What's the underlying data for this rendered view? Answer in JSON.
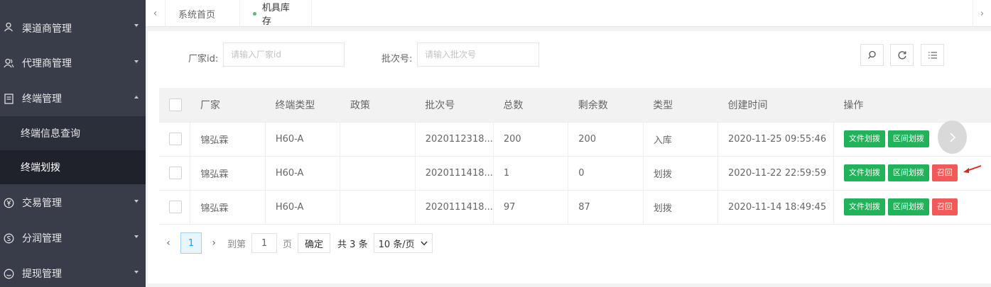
{
  "sidebar": {
    "items": [
      {
        "label": "渠道商管理",
        "icon": "user-icon",
        "expanded": false
      },
      {
        "label": "代理商管理",
        "icon": "users-icon",
        "expanded": false
      },
      {
        "label": "终端管理",
        "icon": "device-icon",
        "expanded": true,
        "children": [
          {
            "label": "终端信息查询",
            "active": false
          },
          {
            "label": "终端划拨",
            "active": true
          }
        ]
      },
      {
        "label": "交易管理",
        "icon": "yen-icon",
        "expanded": false
      },
      {
        "label": "分润管理",
        "icon": "dollar-icon",
        "expanded": false
      },
      {
        "label": "提现管理",
        "icon": "withdraw-icon",
        "expanded": false
      }
    ]
  },
  "tabs": [
    {
      "label": "系统首页",
      "active": false
    },
    {
      "label": "机具库存",
      "active": true
    }
  ],
  "search": {
    "manufacturer_label": "厂家id:",
    "manufacturer_placeholder": "请输入厂家id",
    "batch_label": "批次号:",
    "batch_placeholder": "请输入批次号"
  },
  "table": {
    "columns": [
      "厂家",
      "终端类型",
      "政策",
      "批次号",
      "总数",
      "剩余数",
      "类型",
      "创建时间",
      "操作"
    ],
    "rows": [
      {
        "vendor": "锦弘霖",
        "terminal_type": "H60-A",
        "policy": "",
        "batch": "2020112318...",
        "total": "200",
        "remaining": "200",
        "type": "入库",
        "created": "2020-11-25 09:55:46",
        "actions": [
          "文件划拨",
          "区间划拨"
        ]
      },
      {
        "vendor": "锦弘霖",
        "terminal_type": "H60-A",
        "policy": "",
        "batch": "2020111418...",
        "total": "1",
        "remaining": "0",
        "type": "划拨",
        "created": "2020-11-22 22:59:59",
        "actions": [
          "文件划拨",
          "区间划拨",
          "召回"
        ]
      },
      {
        "vendor": "锦弘霖",
        "terminal_type": "H60-A",
        "policy": "",
        "batch": "2020111418...",
        "total": "97",
        "remaining": "87",
        "type": "划拨",
        "created": "2020-11-14 18:49:45",
        "actions": [
          "文件划拨",
          "区间划拨",
          "召回"
        ]
      }
    ]
  },
  "pager": {
    "current": "1",
    "goto_label": "到第",
    "goto_value": "1",
    "page_unit": "页",
    "confirm": "确定",
    "total": "共 3 条",
    "page_size": "10 条/页"
  },
  "colors": {
    "sidebar_bg": "#393d49",
    "green_button": "#20b35a",
    "red_button": "#f05a5a",
    "accent_blue": "#1e9fff"
  }
}
